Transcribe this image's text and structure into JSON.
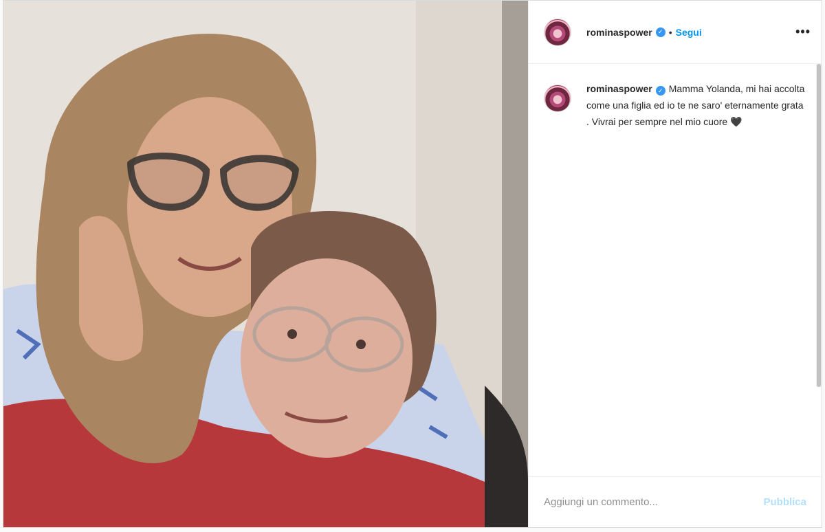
{
  "post": {
    "author": {
      "username": "rominaspower",
      "verified_icon": "verified-badge-icon",
      "avatar": "avatar-image"
    },
    "header": {
      "separator": "•",
      "follow_label": "Segui",
      "more_icon": "more-options-icon",
      "more_label": "•••"
    },
    "caption": {
      "username": "rominaspower",
      "text": "Mamma Yolanda, mi hai accolta come una figlia ed io te ne saro' eternamente grata . Vivrai per sempre nel mio cuore 🖤"
    },
    "comment": {
      "placeholder": "Aggiungi un commento...",
      "publish_label": "Pubblica"
    },
    "colors": {
      "accent": "#0095f6",
      "publish_disabled": "#b2dffc",
      "verified": "#3897f0",
      "border": "#dbdbdb"
    }
  }
}
